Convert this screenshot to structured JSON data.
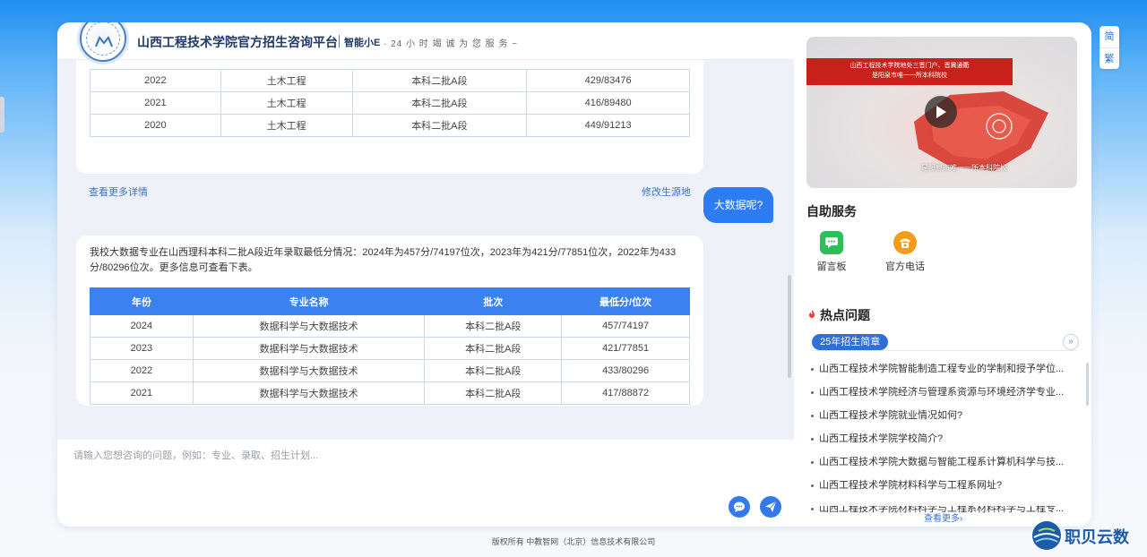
{
  "header": {
    "title": "山西工程技术学院官方招生咨询平台",
    "assistant_name": "智能小E",
    "slogan": "· 24 小 时 竭 诚 为 您 服 务 ~"
  },
  "chat": {
    "messages": [
      {
        "role": "bot",
        "table": {
          "rows": [
            [
              "2022",
              "土木工程",
              "本科二批A段",
              "429/83476"
            ],
            [
              "2021",
              "土木工程",
              "本科二批A段",
              "416/89480"
            ],
            [
              "2020",
              "土木工程",
              "本科二批A段",
              "449/91213"
            ]
          ]
        },
        "more_link": "查看更多详情",
        "edit_link": "修改生源地"
      },
      {
        "role": "user",
        "text": "大数据呢?"
      },
      {
        "role": "bot",
        "text": "我校大数据专业在山西理科本科二批A段近年录取最低分情况：2024年为457分/74197位次，2023年为421分/77851位次，2022年为433分/80296位次。更多信息可查看下表。",
        "table": {
          "headers": [
            "年份",
            "专业名称",
            "批次",
            "最低分/位次"
          ],
          "rows": [
            [
              "2024",
              "数据科学与大数据技术",
              "本科二批A段",
              "457/74197"
            ],
            [
              "2023",
              "数据科学与大数据技术",
              "本科二批A段",
              "421/77851"
            ],
            [
              "2022",
              "数据科学与大数据技术",
              "本科二批A段",
              "433/80296"
            ],
            [
              "2021",
              "数据科学与大数据技术",
              "本科二批A段",
              "417/88872"
            ]
          ]
        }
      }
    ],
    "input_placeholder": "请输入您想咨询的问题，例如：专业、录取、招生计划..."
  },
  "video": {
    "banner": "山西工程技术学院地处三晋门户、晋冀通衢\n是阳泉市唯一一所本科院校",
    "caption": "是阳泉市唯一一所本科院校"
  },
  "self_service": {
    "title": "自助服务",
    "items": [
      {
        "label": "留言板",
        "icon": "message-board-icon",
        "color": "#2fbf5a"
      },
      {
        "label": "官方电话",
        "icon": "phone-icon",
        "color": "#f29b1d"
      }
    ]
  },
  "hot": {
    "title": "热点问题",
    "tag": "25年招生简章",
    "questions": [
      "山西工程技术学院智能制造工程专业的学制和授予学位...",
      "山西工程技术学院经济与管理系资源与环境经济学专业...",
      "山西工程技术学院就业情况如何?",
      "山西工程技术学院学校简介?",
      "山西工程技术学院大数据与智能工程系计算机科学与技...",
      "山西工程技术学院材料科学与工程系网址?",
      "山西工程技术学院材料科学与工程系材料科学与工程专..."
    ],
    "see_more": "查看更多"
  },
  "lang": {
    "simplified": "简",
    "traditional": "繁"
  },
  "footer": "版权所有  中教智网（北京）信息技术有限公司",
  "watermark": "职贝云数",
  "colors": {
    "accent": "#2d7cf2",
    "table_header": "#3b82f0",
    "link": "#3a72c8"
  }
}
